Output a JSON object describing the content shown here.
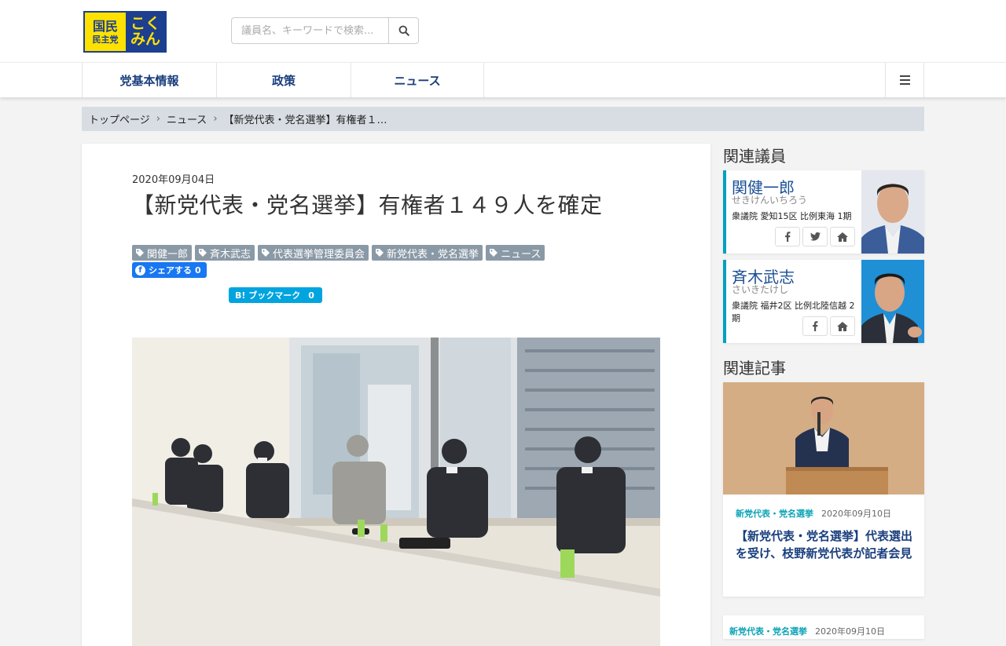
{
  "header": {
    "logo": {
      "line1": "国民",
      "line2": "民主党",
      "line3": "こく",
      "line4": "みん"
    },
    "search": {
      "placeholder": "議員名、キーワードで検索..."
    }
  },
  "nav": {
    "items": [
      "党基本情報",
      "政策",
      "ニュース"
    ]
  },
  "breadcrumb": {
    "items": [
      "トップページ",
      "ニュース",
      "【新党代表・党名選挙】有権者１…"
    ],
    "separator": "›"
  },
  "article": {
    "date": "2020年09月04日",
    "title": "【新党代表・党名選挙】有権者１４９人を確定",
    "tags": [
      "関健一郎",
      "斉木武志",
      "代表選挙管理委員会",
      "新党代表・党名選挙",
      "ニュース"
    ],
    "share": {
      "fb_label": "シェアする",
      "fb_count": "0",
      "hatena_label": "B! ブックマーク",
      "hatena_count": "0"
    }
  },
  "sidebar": {
    "members_heading": "関連議員",
    "members": [
      {
        "name": "関健一郎",
        "kana": "せきけんいちろう",
        "info": "衆議院 愛知15区 比例東海 1期"
      },
      {
        "name": "斉木武志",
        "kana": "さいきたけし",
        "info": "衆議院 福井2区 比例北陸信越 2期"
      }
    ],
    "articles_heading": "関連記事",
    "related": [
      {
        "category": "新党代表・党名選挙",
        "date": "2020年09月10日",
        "title": "【新党代表・党名選挙】代表選出を受け、枝野新党代表が記者会見"
      },
      {
        "category": "新党代表・党名選挙",
        "date": "2020年09月10日"
      }
    ]
  },
  "colors": {
    "brand_blue": "#1d3f8f",
    "brand_yellow": "#ffe100",
    "accent_teal": "#00a0be",
    "tag_gray": "#8a99a6"
  }
}
